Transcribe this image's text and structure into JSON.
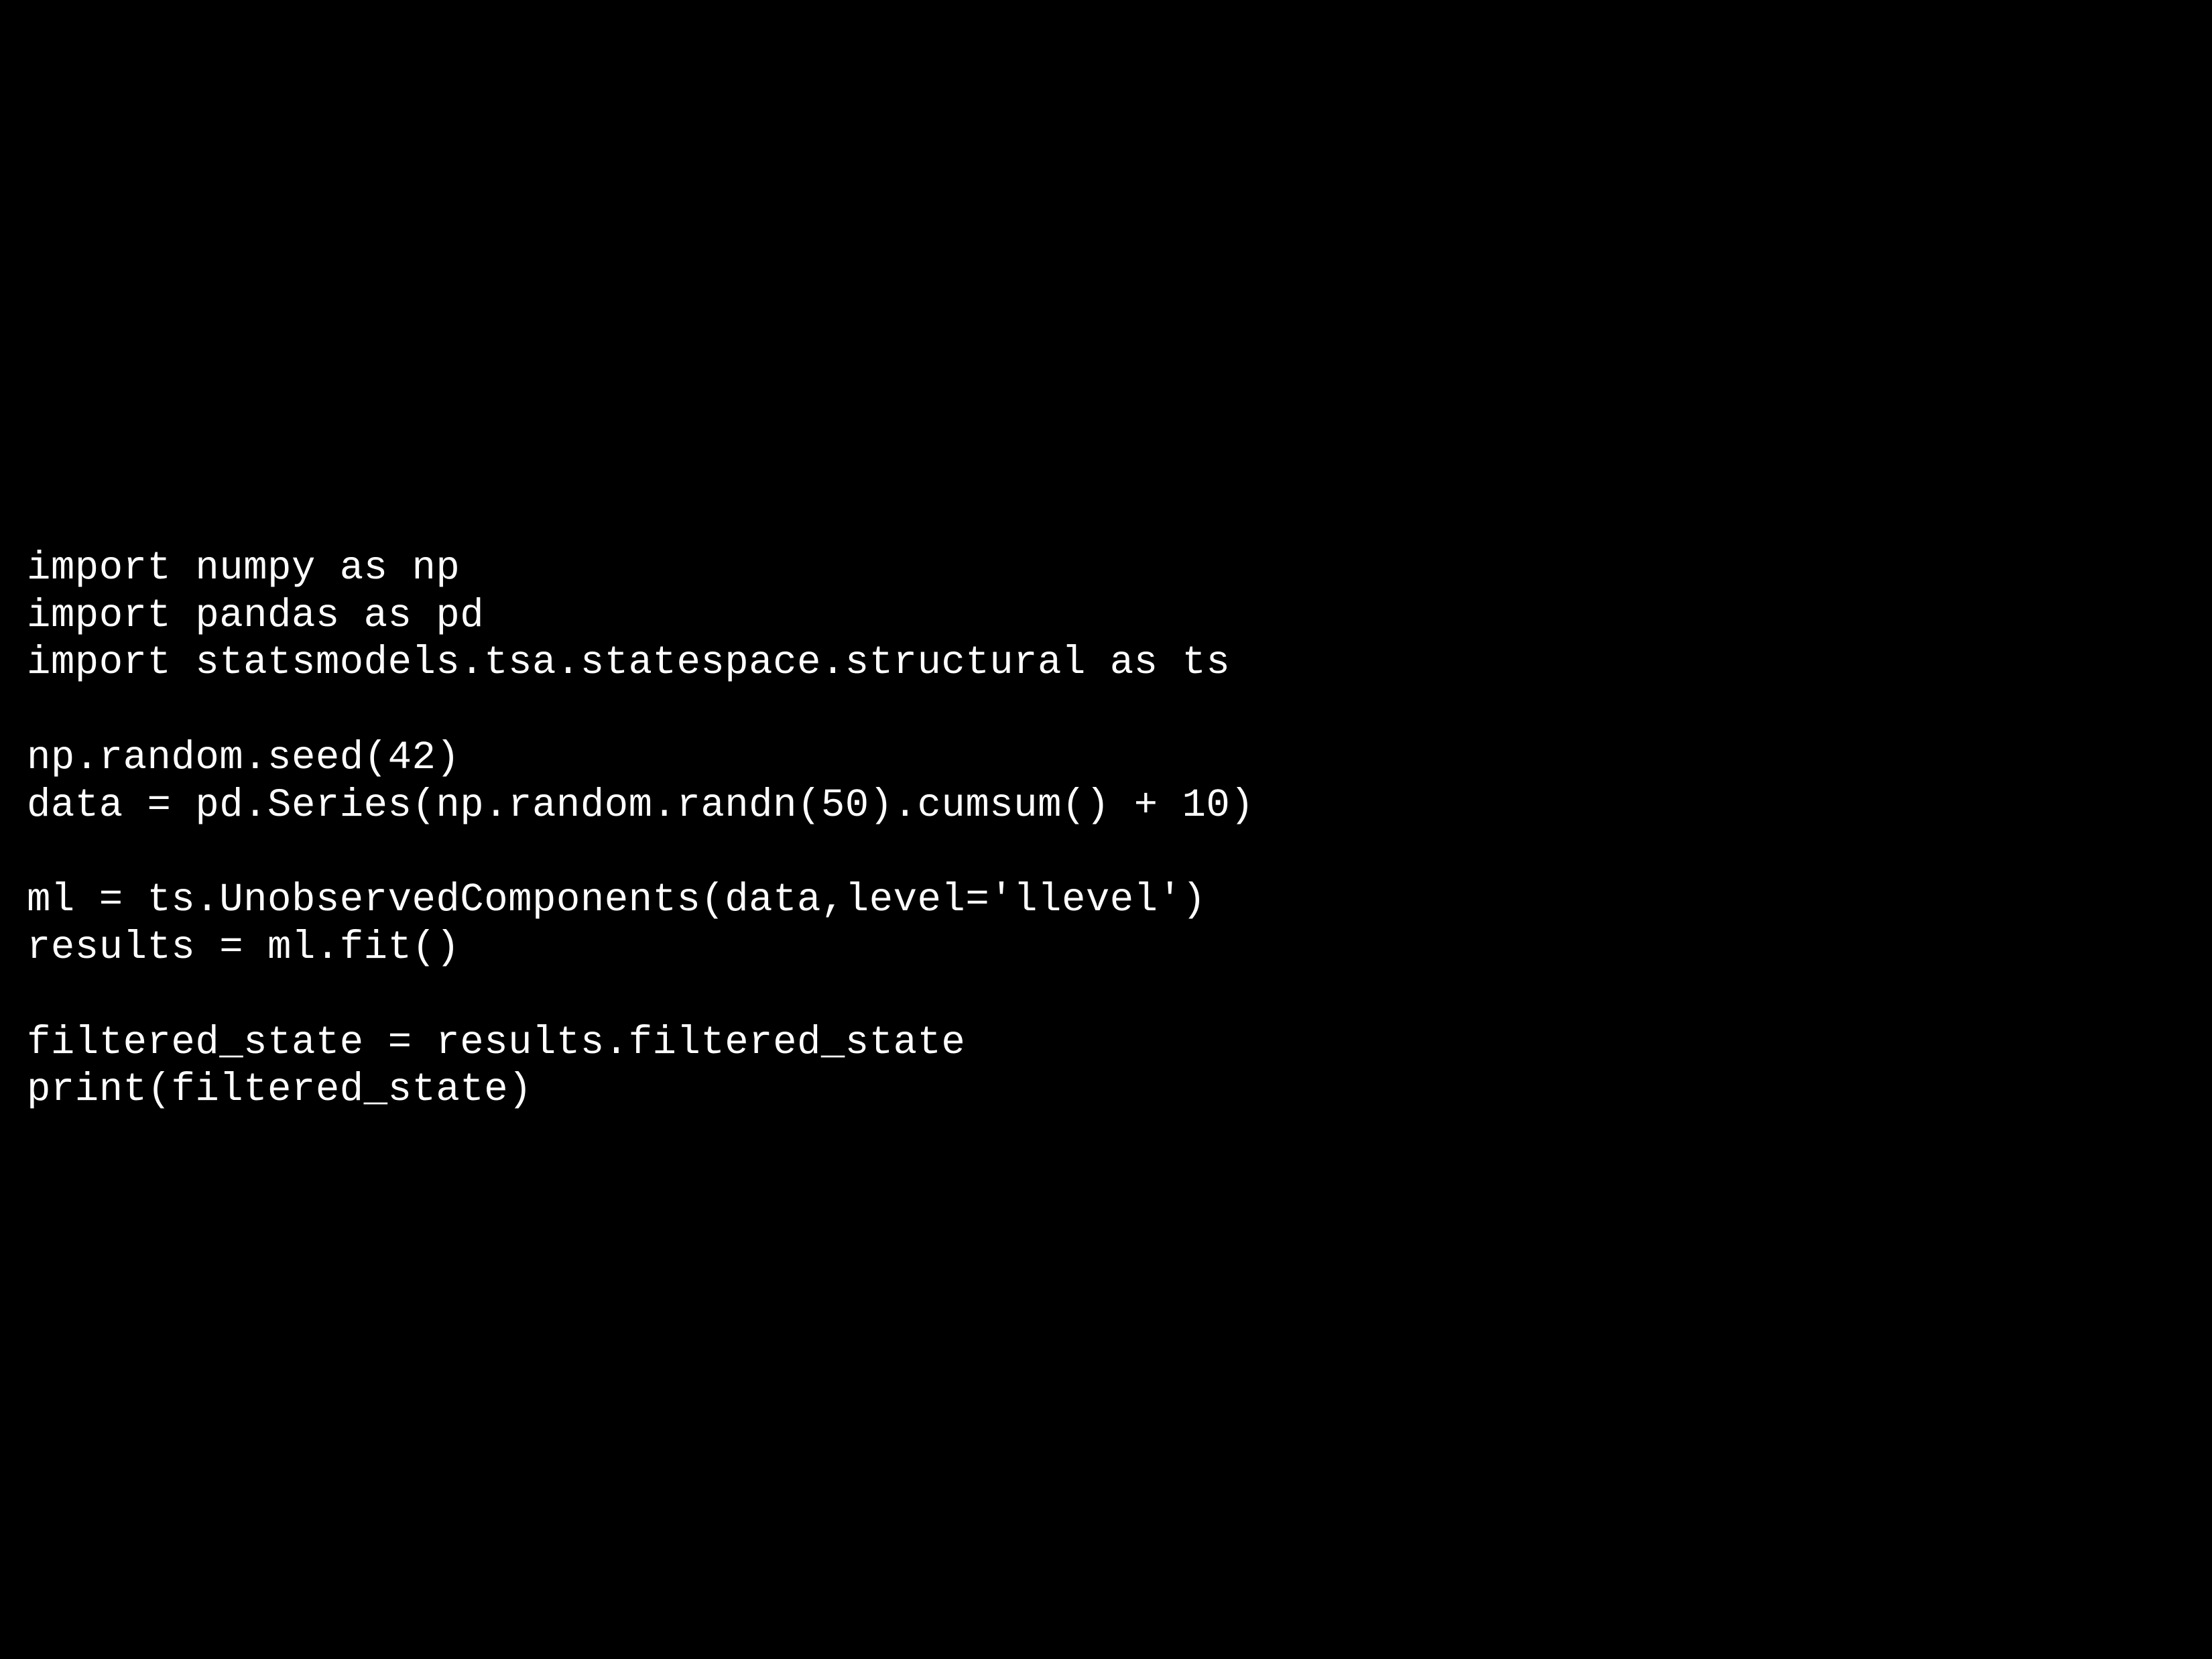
{
  "code": {
    "line1": "import numpy as np",
    "line2": "import pandas as pd",
    "line3": "import statsmodels.tsa.statespace.structural as ts",
    "line4": "",
    "line5": "np.random.seed(42)",
    "line6": "data = pd.Series(np.random.randn(50).cumsum() + 10)",
    "line7": "",
    "line8": "ml = ts.UnobservedComponents(data,level='llevel')",
    "line9": "results = ml.fit()",
    "line10": "",
    "line11": "filtered_state = results.filtered_state",
    "line12": "print(filtered_state)"
  }
}
